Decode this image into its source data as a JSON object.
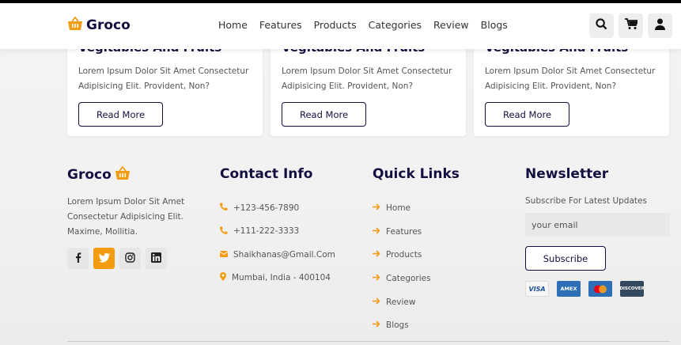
{
  "header": {
    "brand": "Groco",
    "nav": [
      "Home",
      "Features",
      "Products",
      "Categories",
      "Review",
      "Blogs"
    ],
    "icons": [
      "search-icon",
      "cart-icon",
      "user-icon"
    ]
  },
  "cards": [
    {
      "title": "Vegitables And Fruits",
      "desc": "Lorem Ipsum Dolor Sit Amet Consectetur Adipisicing Elit. Provident, Non?",
      "button": "Read More"
    },
    {
      "title": "Vegitables And Fruits",
      "desc": "Lorem Ipsum Dolor Sit Amet Consectetur Adipisicing Elit. Provident, Non?",
      "button": "Read More"
    },
    {
      "title": "Vegitables And Fruits",
      "desc": "Lorem Ipsum Dolor Sit Amet Consectetur Adipisicing Elit. Provident, Non?",
      "button": "Read More"
    }
  ],
  "footer": {
    "brand": "Groco",
    "about": "Lorem Ipsum Dolor Sit Amet Consectetur Adipisicing Elit. Maxime, Mollitia.",
    "socials": [
      "facebook-icon",
      "twitter-icon",
      "instagram-icon",
      "linkedin-icon"
    ],
    "contact_title": "Contact Info",
    "contacts": [
      {
        "icon": "phone-icon",
        "text": "+123-456-7890"
      },
      {
        "icon": "phone-icon",
        "text": "+111-222-3333"
      },
      {
        "icon": "envelope-icon",
        "text": "Shaikhanas@Gmail.Com"
      },
      {
        "icon": "map-marker-icon",
        "text": "Mumbai, India - 400104"
      }
    ],
    "links_title": "Quick Links",
    "links": [
      "Home",
      "Features",
      "Products",
      "Categories",
      "Review",
      "Blogs"
    ],
    "newsletter_title": "Newsletter",
    "newsletter_sub": "Subscribe For Latest Updates",
    "email_placeholder": "your email",
    "subscribe_label": "Subscribe",
    "payments": [
      {
        "name": "visa",
        "label": "VISA",
        "color": "#f5f5f5"
      },
      {
        "name": "amex",
        "label": "AMEX",
        "color": "#2d6fb6"
      },
      {
        "name": "mastercard",
        "label": "",
        "color": "#2d6fb6"
      },
      {
        "name": "discover",
        "label": "DISCOVER",
        "color": "#34495e"
      }
    ]
  },
  "colors": {
    "accent": "#f39c12",
    "dark": "#130f40"
  }
}
